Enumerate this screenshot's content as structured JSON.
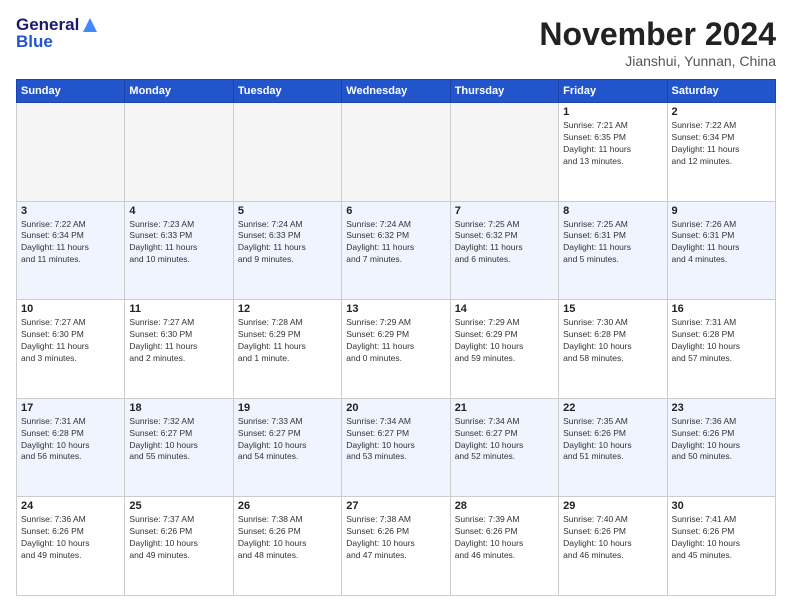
{
  "header": {
    "logo_general": "General",
    "logo_blue": "Blue",
    "month_year": "November 2024",
    "location": "Jianshui, Yunnan, China"
  },
  "weekdays": [
    "Sunday",
    "Monday",
    "Tuesday",
    "Wednesday",
    "Thursday",
    "Friday",
    "Saturday"
  ],
  "weeks": [
    [
      {
        "day": "",
        "info": "",
        "empty": true
      },
      {
        "day": "",
        "info": "",
        "empty": true
      },
      {
        "day": "",
        "info": "",
        "empty": true
      },
      {
        "day": "",
        "info": "",
        "empty": true
      },
      {
        "day": "",
        "info": "",
        "empty": true
      },
      {
        "day": "1",
        "info": "Sunrise: 7:21 AM\nSunset: 6:35 PM\nDaylight: 11 hours\nand 13 minutes."
      },
      {
        "day": "2",
        "info": "Sunrise: 7:22 AM\nSunset: 6:34 PM\nDaylight: 11 hours\nand 12 minutes."
      }
    ],
    [
      {
        "day": "3",
        "info": "Sunrise: 7:22 AM\nSunset: 6:34 PM\nDaylight: 11 hours\nand 11 minutes."
      },
      {
        "day": "4",
        "info": "Sunrise: 7:23 AM\nSunset: 6:33 PM\nDaylight: 11 hours\nand 10 minutes."
      },
      {
        "day": "5",
        "info": "Sunrise: 7:24 AM\nSunset: 6:33 PM\nDaylight: 11 hours\nand 9 minutes."
      },
      {
        "day": "6",
        "info": "Sunrise: 7:24 AM\nSunset: 6:32 PM\nDaylight: 11 hours\nand 7 minutes."
      },
      {
        "day": "7",
        "info": "Sunrise: 7:25 AM\nSunset: 6:32 PM\nDaylight: 11 hours\nand 6 minutes."
      },
      {
        "day": "8",
        "info": "Sunrise: 7:25 AM\nSunset: 6:31 PM\nDaylight: 11 hours\nand 5 minutes."
      },
      {
        "day": "9",
        "info": "Sunrise: 7:26 AM\nSunset: 6:31 PM\nDaylight: 11 hours\nand 4 minutes."
      }
    ],
    [
      {
        "day": "10",
        "info": "Sunrise: 7:27 AM\nSunset: 6:30 PM\nDaylight: 11 hours\nand 3 minutes."
      },
      {
        "day": "11",
        "info": "Sunrise: 7:27 AM\nSunset: 6:30 PM\nDaylight: 11 hours\nand 2 minutes."
      },
      {
        "day": "12",
        "info": "Sunrise: 7:28 AM\nSunset: 6:29 PM\nDaylight: 11 hours\nand 1 minute."
      },
      {
        "day": "13",
        "info": "Sunrise: 7:29 AM\nSunset: 6:29 PM\nDaylight: 11 hours\nand 0 minutes."
      },
      {
        "day": "14",
        "info": "Sunrise: 7:29 AM\nSunset: 6:29 PM\nDaylight: 10 hours\nand 59 minutes."
      },
      {
        "day": "15",
        "info": "Sunrise: 7:30 AM\nSunset: 6:28 PM\nDaylight: 10 hours\nand 58 minutes."
      },
      {
        "day": "16",
        "info": "Sunrise: 7:31 AM\nSunset: 6:28 PM\nDaylight: 10 hours\nand 57 minutes."
      }
    ],
    [
      {
        "day": "17",
        "info": "Sunrise: 7:31 AM\nSunset: 6:28 PM\nDaylight: 10 hours\nand 56 minutes."
      },
      {
        "day": "18",
        "info": "Sunrise: 7:32 AM\nSunset: 6:27 PM\nDaylight: 10 hours\nand 55 minutes."
      },
      {
        "day": "19",
        "info": "Sunrise: 7:33 AM\nSunset: 6:27 PM\nDaylight: 10 hours\nand 54 minutes."
      },
      {
        "day": "20",
        "info": "Sunrise: 7:34 AM\nSunset: 6:27 PM\nDaylight: 10 hours\nand 53 minutes."
      },
      {
        "day": "21",
        "info": "Sunrise: 7:34 AM\nSunset: 6:27 PM\nDaylight: 10 hours\nand 52 minutes."
      },
      {
        "day": "22",
        "info": "Sunrise: 7:35 AM\nSunset: 6:26 PM\nDaylight: 10 hours\nand 51 minutes."
      },
      {
        "day": "23",
        "info": "Sunrise: 7:36 AM\nSunset: 6:26 PM\nDaylight: 10 hours\nand 50 minutes."
      }
    ],
    [
      {
        "day": "24",
        "info": "Sunrise: 7:36 AM\nSunset: 6:26 PM\nDaylight: 10 hours\nand 49 minutes."
      },
      {
        "day": "25",
        "info": "Sunrise: 7:37 AM\nSunset: 6:26 PM\nDaylight: 10 hours\nand 49 minutes."
      },
      {
        "day": "26",
        "info": "Sunrise: 7:38 AM\nSunset: 6:26 PM\nDaylight: 10 hours\nand 48 minutes."
      },
      {
        "day": "27",
        "info": "Sunrise: 7:38 AM\nSunset: 6:26 PM\nDaylight: 10 hours\nand 47 minutes."
      },
      {
        "day": "28",
        "info": "Sunrise: 7:39 AM\nSunset: 6:26 PM\nDaylight: 10 hours\nand 46 minutes."
      },
      {
        "day": "29",
        "info": "Sunrise: 7:40 AM\nSunset: 6:26 PM\nDaylight: 10 hours\nand 46 minutes."
      },
      {
        "day": "30",
        "info": "Sunrise: 7:41 AM\nSunset: 6:26 PM\nDaylight: 10 hours\nand 45 minutes."
      }
    ]
  ]
}
